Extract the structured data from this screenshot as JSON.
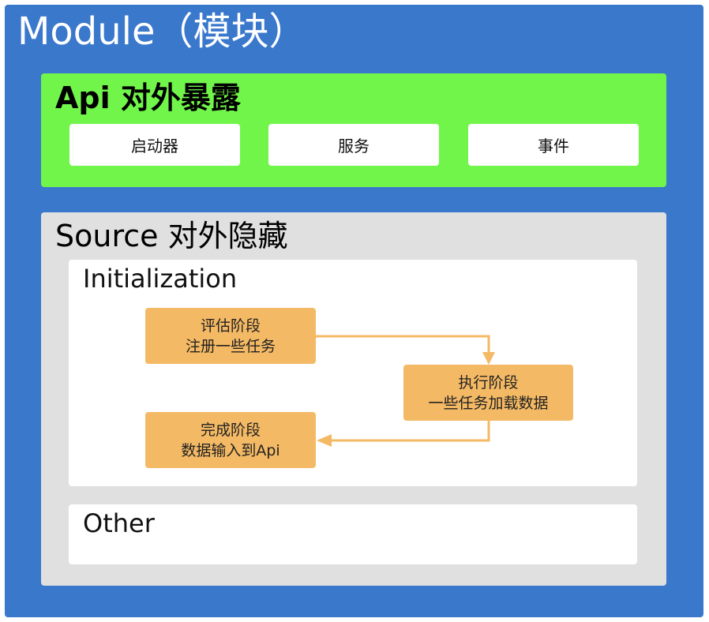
{
  "module": {
    "title": "Module（模块）"
  },
  "api": {
    "title": "Api 对外暴露",
    "items": [
      {
        "label": "启动器"
      },
      {
        "label": "服务"
      },
      {
        "label": "事件"
      }
    ]
  },
  "source": {
    "title": "Source 对外隐藏",
    "initialization": {
      "title": "Initialization",
      "steps": [
        {
          "line1": "评估阶段",
          "line2": "注册一些任务"
        },
        {
          "line1": "执行阶段",
          "line2": "一些任务加载数据"
        },
        {
          "line1": "完成阶段",
          "line2": "数据输入到Api"
        }
      ]
    },
    "other": {
      "title": "Other"
    }
  },
  "colors": {
    "module_bg": "#3a78cc",
    "api_bg": "#72f54a",
    "source_bg": "#e0e0e0",
    "step_bg": "#f4b964",
    "arrow": "#f4b964"
  }
}
